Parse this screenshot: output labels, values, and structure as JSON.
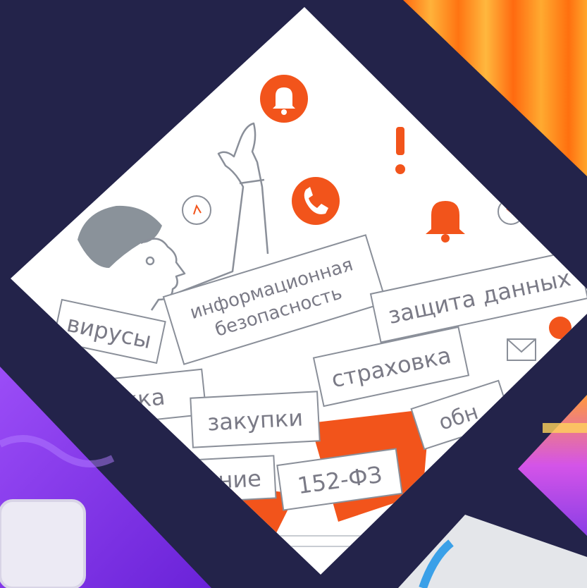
{
  "colors": {
    "background": "#23234a",
    "accent_orange": "#f2541b",
    "illustration_bg": "#ffffff",
    "line": "#8a8f99",
    "text": "#7a7a86",
    "purple": "#8b3cf0",
    "stage_curtain": "#ff7a14"
  },
  "tags": {
    "viruses": "вирусы",
    "infosec_line1": "информационная",
    "infosec_line2": "безопасность",
    "data_protection": "защита данных",
    "insurance": "страховка",
    "support": "ржка",
    "purchases": "закупки",
    "update": "обн",
    "rening": "рение",
    "law": "152-ФЗ"
  },
  "icons": [
    "bell-icon",
    "phone-icon",
    "exclamation-icon",
    "clock-icon",
    "envelope-icon"
  ]
}
